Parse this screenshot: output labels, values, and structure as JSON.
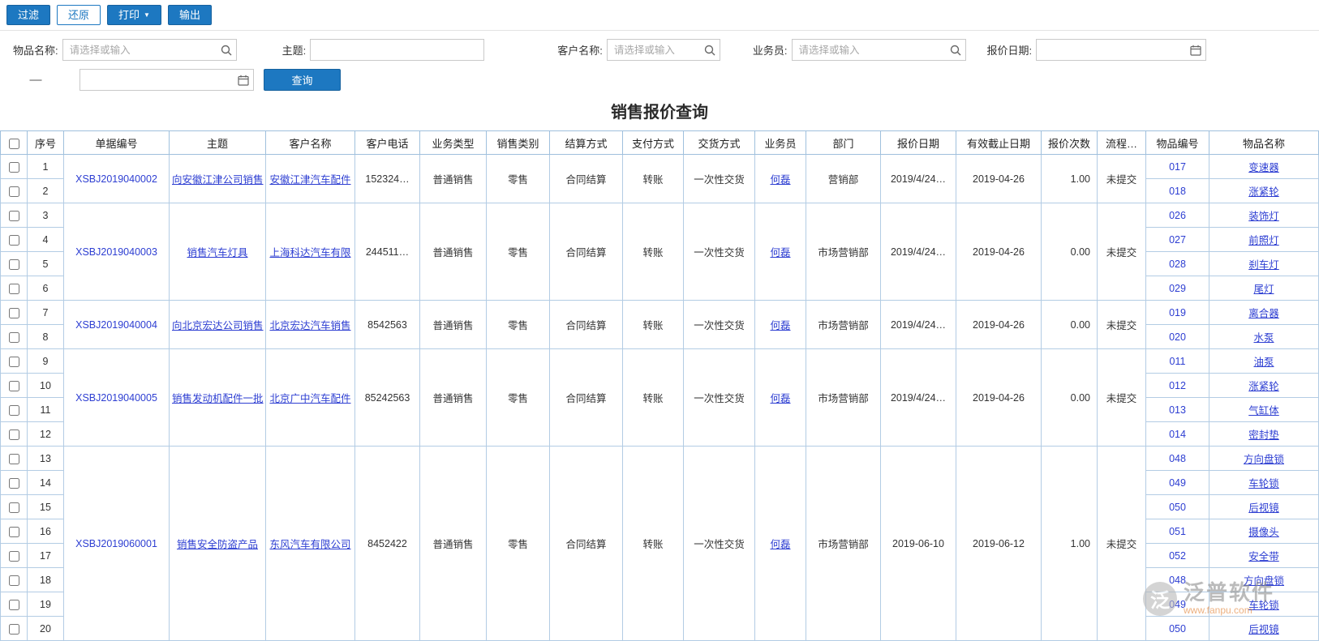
{
  "toolbar": {
    "filter": "过滤",
    "restore": "还原",
    "print": "打印",
    "print_caret": "▼",
    "export": "输出"
  },
  "filters": {
    "item_name": {
      "label": "物品名称:",
      "placeholder": "请选择或输入",
      "value": ""
    },
    "subject": {
      "label": "主题:",
      "value": ""
    },
    "customer": {
      "label": "客户名称:",
      "placeholder": "请选择或输入",
      "value": ""
    },
    "salesman": {
      "label": "业务员:",
      "placeholder": "请选择或输入",
      "value": ""
    },
    "quote_date": {
      "label": "报价日期:",
      "value": ""
    },
    "date_range_separator": "—",
    "quote_date_end": {
      "value": ""
    },
    "search_button": "查询"
  },
  "page_title": "销售报价查询",
  "icons": {
    "search": "magnifier",
    "calendar": "calendar",
    "logo_glyph": "泛"
  },
  "table": {
    "headers": [
      "序号",
      "单据编号",
      "主题",
      "客户名称",
      "客户电话",
      "业务类型",
      "销售类别",
      "结算方式",
      "支付方式",
      "交货方式",
      "业务员",
      "部门",
      "报价日期",
      "有效截止日期",
      "报价次数",
      "流程…",
      "物品编号",
      "物品名称"
    ],
    "documents": [
      {
        "doc_no": "XSBJ2019040002",
        "subject": "向安徽江津公司销售",
        "customer": "安徽江津汽车配件",
        "phone": "152324…",
        "business_type": "普通销售",
        "sales_category": "零售",
        "settlement": "合同结算",
        "payment": "转账",
        "delivery": "一次性交货",
        "salesman": "何磊",
        "department": "营销部",
        "quote_date": "2019/4/24…",
        "valid_until": "2019-04-26",
        "quote_count": "1.00",
        "flow_status": "未提交",
        "items": [
          {
            "code": "017",
            "name": "变速器"
          },
          {
            "code": "018",
            "name": "涨紧轮"
          }
        ]
      },
      {
        "doc_no": "XSBJ2019040003",
        "subject": "销售汽车灯具",
        "customer": "上海科达汽车有限",
        "phone": "244511…",
        "business_type": "普通销售",
        "sales_category": "零售",
        "settlement": "合同结算",
        "payment": "转账",
        "delivery": "一次性交货",
        "salesman": "何磊",
        "department": "市场营销部",
        "quote_date": "2019/4/24…",
        "valid_until": "2019-04-26",
        "quote_count": "0.00",
        "flow_status": "未提交",
        "items": [
          {
            "code": "026",
            "name": "装饰灯"
          },
          {
            "code": "027",
            "name": "前照灯"
          },
          {
            "code": "028",
            "name": "刹车灯"
          },
          {
            "code": "029",
            "name": "尾灯"
          }
        ]
      },
      {
        "doc_no": "XSBJ2019040004",
        "subject": "向北京宏达公司销售",
        "customer": "北京宏达汽车销售",
        "phone": "8542563",
        "business_type": "普通销售",
        "sales_category": "零售",
        "settlement": "合同结算",
        "payment": "转账",
        "delivery": "一次性交货",
        "salesman": "何磊",
        "department": "市场营销部",
        "quote_date": "2019/4/24…",
        "valid_until": "2019-04-26",
        "quote_count": "0.00",
        "flow_status": "未提交",
        "items": [
          {
            "code": "019",
            "name": "离合器"
          },
          {
            "code": "020",
            "name": "水泵"
          }
        ]
      },
      {
        "doc_no": "XSBJ2019040005",
        "subject": "销售发动机配件一批",
        "customer": "北京广中汽车配件",
        "phone": "85242563",
        "business_type": "普通销售",
        "sales_category": "零售",
        "settlement": "合同结算",
        "payment": "转账",
        "delivery": "一次性交货",
        "salesman": "何磊",
        "department": "市场营销部",
        "quote_date": "2019/4/24…",
        "valid_until": "2019-04-26",
        "quote_count": "0.00",
        "flow_status": "未提交",
        "items": [
          {
            "code": "011",
            "name": "油泵"
          },
          {
            "code": "012",
            "name": "涨紧轮"
          },
          {
            "code": "013",
            "name": "气缸体"
          },
          {
            "code": "014",
            "name": "密封垫"
          }
        ]
      },
      {
        "doc_no": "XSBJ2019060001",
        "subject": "销售安全防盗产品",
        "customer": "东风汽车有限公司",
        "phone": "8452422",
        "business_type": "普通销售",
        "sales_category": "零售",
        "settlement": "合同结算",
        "payment": "转账",
        "delivery": "一次性交货",
        "salesman": "何磊",
        "department": "市场营销部",
        "quote_date": "2019-06-10",
        "valid_until": "2019-06-12",
        "quote_count": "1.00",
        "flow_status": "未提交",
        "items": [
          {
            "code": "048",
            "name": "方向盘锁"
          },
          {
            "code": "049",
            "name": "车轮锁"
          },
          {
            "code": "050",
            "name": "后视镜"
          },
          {
            "code": "051",
            "name": "摄像头"
          },
          {
            "code": "052",
            "name": "安全带"
          },
          {
            "code": "048",
            "name": "方向盘锁"
          },
          {
            "code": "049",
            "name": "车轮锁"
          },
          {
            "code": "050",
            "name": "后视镜"
          }
        ]
      }
    ]
  },
  "watermark": {
    "brand": "泛普软件",
    "url": "www.fanpu.com"
  },
  "colors": {
    "primary_blue": "#1d78c1",
    "link_blue": "#2d3ed2",
    "table_border": "#b3cce4"
  }
}
